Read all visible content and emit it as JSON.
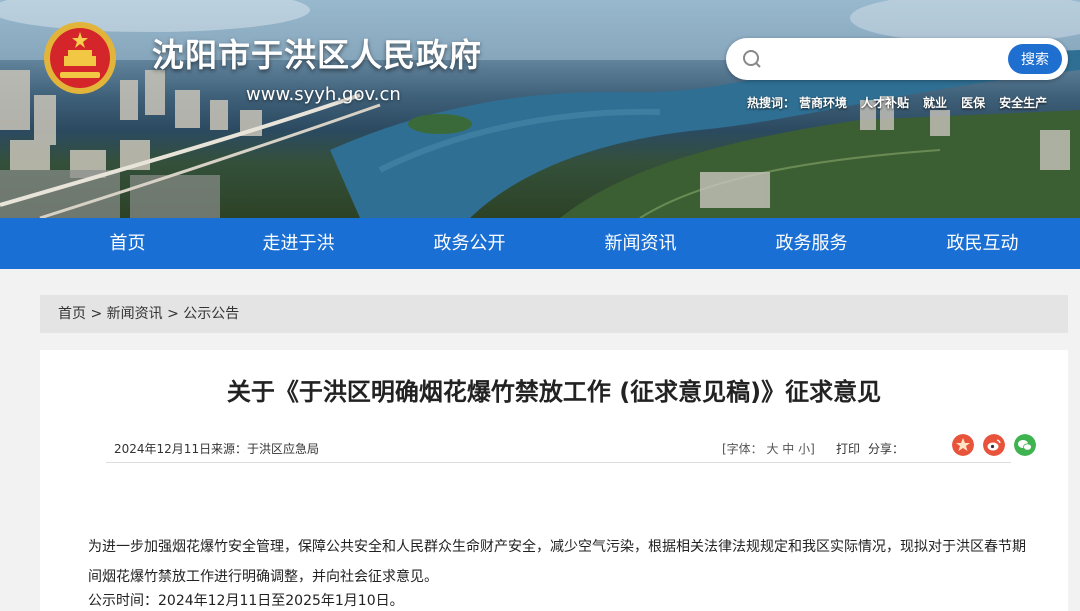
{
  "header": {
    "site_title": "沈阳市于洪区人民政府",
    "site_url": "www.syyh.gov.cn",
    "search": {
      "placeholder": "",
      "button_label": "搜索"
    },
    "hot_label": "热搜词：",
    "hot_words": [
      "营商环境",
      "人才补贴",
      "就业",
      "医保",
      "安全生产"
    ]
  },
  "nav": {
    "items": [
      "首页",
      "走进于洪",
      "政务公开",
      "新闻资讯",
      "政务服务",
      "政民互动"
    ]
  },
  "breadcrumb": {
    "text": "首页 > 新闻资讯 > 公示公告"
  },
  "article": {
    "title": "关于《于洪区明确烟花爆竹禁放工作 (征求意见稿)》征求意见",
    "date": "2024年12月11日",
    "source": "来源：于洪区应急局",
    "font_size_control": "[字体： 大 中 小]",
    "print_label": "打印",
    "share_label": "分享：",
    "paragraph1": "为进一步加强烟花爆竹安全管理，保障公共安全和人民群众生命财产安全，减少空气污染，根据相关法律法规规定和我区实际情况，现拟对于洪区春节期间烟花爆竹禁放工作进行明确调整，并向社会征求意见。",
    "paragraph2": "公示时间：2024年12月11日至2025年1月10日。"
  },
  "colors": {
    "nav_blue": "#1a6fd4",
    "search_button": "#1f6fd0",
    "weibo_red": "#e8533b",
    "wechat_green": "#3fb34f"
  },
  "icons": [
    "national-emblem-icon",
    "search-icon",
    "share-qq-icon",
    "share-weibo-icon",
    "share-wechat-icon"
  ]
}
